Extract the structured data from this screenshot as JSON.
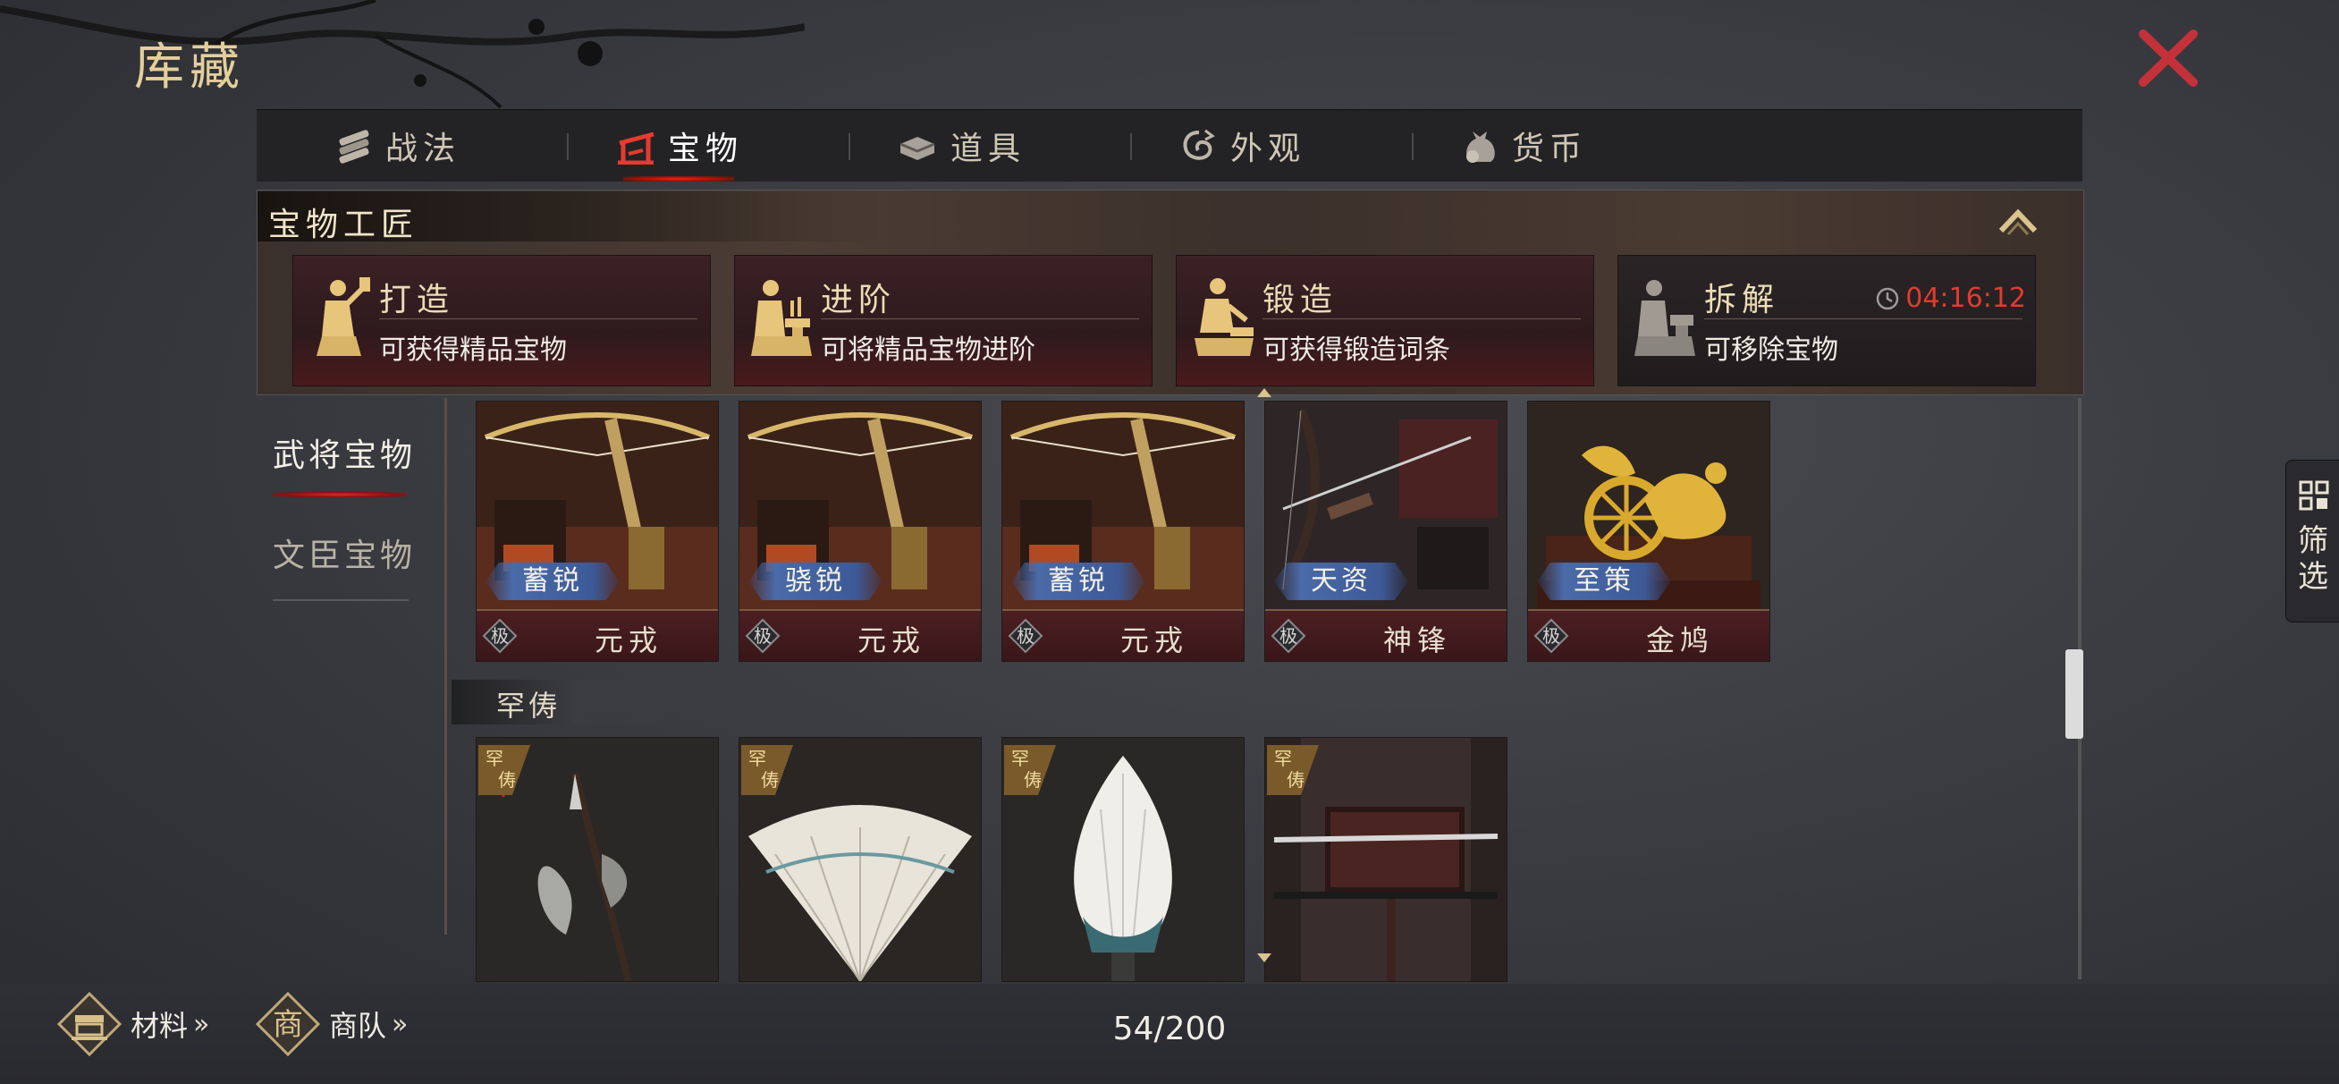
{
  "window": {
    "title": "库藏",
    "close_icon": "close-x-icon"
  },
  "tabs": [
    {
      "label": "战法",
      "icon": "scroll-bundle-icon",
      "active": false
    },
    {
      "label": "宝物",
      "icon": "treasure-arch-icon",
      "active": true
    },
    {
      "label": "道具",
      "icon": "ingot-icon",
      "active": false
    },
    {
      "label": "外观",
      "icon": "swirl-icon",
      "active": false
    },
    {
      "label": "货币",
      "icon": "coin-bag-icon",
      "active": false
    }
  ],
  "artisan": {
    "title": "宝物工匠",
    "collapse_icon": "chevron-up-icon",
    "cards": [
      {
        "title": "打造",
        "subtitle": "可获得精品宝物",
        "icon": "smith-hammer-icon"
      },
      {
        "title": "进阶",
        "subtitle": "可将精品宝物进阶",
        "icon": "smith-anvil-icon"
      },
      {
        "title": "锻造",
        "subtitle": "可获得锻造词条",
        "icon": "smith-forge-icon"
      },
      {
        "title": "拆解",
        "subtitle": "可移除宝物",
        "icon": "smith-dismantle-icon",
        "timer": "04:16:12",
        "timer_color": "#e23b2e"
      }
    ]
  },
  "subnav": [
    {
      "label": "武将宝物",
      "active": true
    },
    {
      "label": "文臣宝物",
      "active": false
    }
  ],
  "treasures": [
    {
      "name": "元戎",
      "tag": "蓄锐",
      "grade": "极"
    },
    {
      "name": "元戎",
      "tag": "骁锐",
      "grade": "极"
    },
    {
      "name": "元戎",
      "tag": "蓄锐",
      "grade": "极"
    },
    {
      "name": "神锋",
      "tag": "天资",
      "grade": "极"
    },
    {
      "name": "金鸠",
      "tag": "至策",
      "grade": "极"
    }
  ],
  "rare_section": {
    "label": "罕俦",
    "badge": "罕俦",
    "items": [
      "halberd",
      "feather-fan",
      "feather-fan-white",
      "sword-rack"
    ]
  },
  "filter": {
    "label": "筛选",
    "icon": "grid-icon"
  },
  "bottom": {
    "materials_label": "材料",
    "caravan_label": "商队",
    "caravan_icon_char": "商",
    "chevron": "»",
    "count": "54/200"
  }
}
